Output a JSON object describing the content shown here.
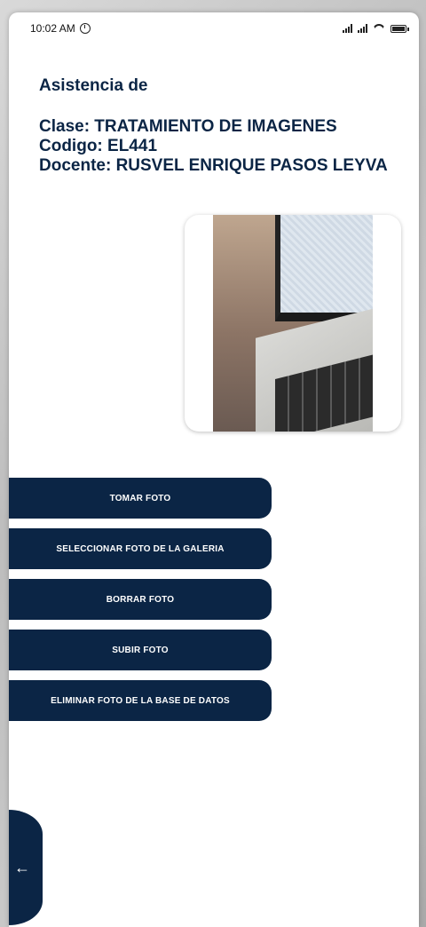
{
  "status_bar": {
    "time": "10:02 AM",
    "alarm_icon": "alarm-icon",
    "signal_icons": [
      "signal-icon",
      "signal-icon"
    ],
    "wifi_icon": "wifi-icon",
    "battery_icon": "battery-icon"
  },
  "header": {
    "title": "Asistencia de"
  },
  "class_info": {
    "clase": "Clase: TRATAMIENTO DE IMAGENES",
    "codigo": "Codigo: EL441",
    "docente": "Docente: RUSVEL ENRIQUE PASOS LEYVA"
  },
  "buttons": {
    "tomar_foto": "TOMAR FOTO",
    "seleccionar_galeria": "SELECCIONAR FOTO DE LA GALERIA",
    "borrar_foto": "BORRAR FOTO",
    "subir_foto": "SUBIR FOTO",
    "eliminar_bd": "ELIMINAR FOTO DE LA BASE DE DATOS"
  },
  "back_tab": {
    "icon": "arrow-left-icon",
    "glyph": "←"
  },
  "colors": {
    "primary": "#0b2545",
    "background": "#ffffff"
  }
}
